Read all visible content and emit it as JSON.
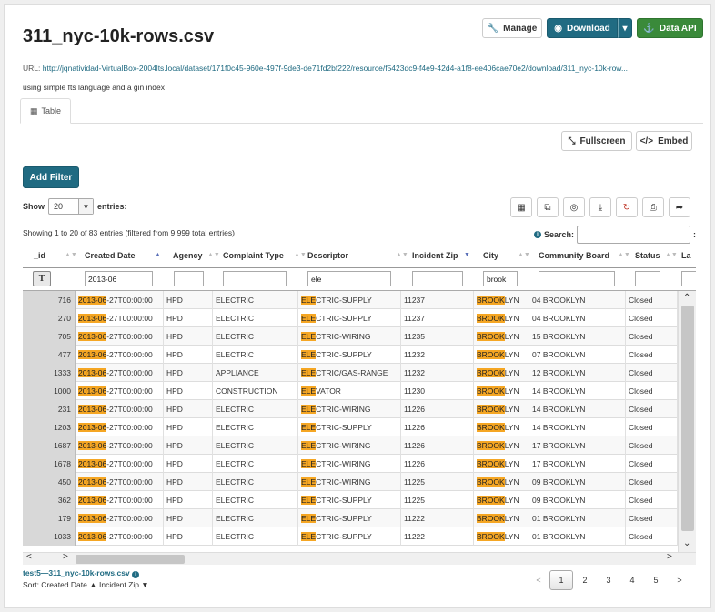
{
  "page": {
    "title": "311_nyc-10k-rows.csv"
  },
  "actions": {
    "manage": "Manage",
    "download": "Download",
    "data_api": "Data API"
  },
  "url": {
    "label": "URL:",
    "href": "http://jqnatividad-VirtualBox-2004lts.local/dataset/171f0c45-960e-497f-9de3-de71fd2bf222/resource/f5423dc9-f4e9-42d4-a1f8-ee406cae70e2/download/311_nyc-10k-row..."
  },
  "description": "using simple fts language and a gin index",
  "tabs": [
    {
      "label": "Table"
    }
  ],
  "view_buttons": {
    "fullscreen": "Fullscreen",
    "embed": "Embed"
  },
  "add_filter": "Add Filter",
  "length": {
    "show": "Show",
    "value": "20",
    "entries": "entries:"
  },
  "info": "Showing 1 to 20 of 83 entries (filtered from 9,999 total entries)",
  "search": {
    "label": "Search:",
    "value": "",
    "trailing": ":"
  },
  "columns": [
    "_id",
    "Created Date",
    "Agency",
    "Complaint Type",
    "Descriptor",
    "Incident Zip",
    "City",
    "Community Board",
    "Status",
    "La"
  ],
  "filters": {
    "created_date": "2013-06",
    "agency": "",
    "complaint_type": "",
    "descriptor": "ele",
    "incident_zip": "",
    "city": "brook",
    "community_board": "",
    "status": "",
    "la": ""
  },
  "highlight": {
    "date": "2013-06",
    "descriptor": "ELE",
    "city": "BROOK"
  },
  "rows": [
    {
      "id": "716",
      "date_rest": "-27T00:00:00",
      "agency": "HPD",
      "type": "ELECTRIC",
      "desc_rest": "CTRIC-SUPPLY",
      "zip": "11237",
      "city_rest": "LYN",
      "board": "04 BROOKLYN",
      "status": "Closed"
    },
    {
      "id": "270",
      "date_rest": "-27T00:00:00",
      "agency": "HPD",
      "type": "ELECTRIC",
      "desc_rest": "CTRIC-SUPPLY",
      "zip": "11237",
      "city_rest": "LYN",
      "board": "04 BROOKLYN",
      "status": "Closed"
    },
    {
      "id": "705",
      "date_rest": "-27T00:00:00",
      "agency": "HPD",
      "type": "ELECTRIC",
      "desc_rest": "CTRIC-WIRING",
      "zip": "11235",
      "city_rest": "LYN",
      "board": "15 BROOKLYN",
      "status": "Closed"
    },
    {
      "id": "477",
      "date_rest": "-27T00:00:00",
      "agency": "HPD",
      "type": "ELECTRIC",
      "desc_rest": "CTRIC-SUPPLY",
      "zip": "11232",
      "city_rest": "LYN",
      "board": "07 BROOKLYN",
      "status": "Closed"
    },
    {
      "id": "1333",
      "date_rest": "-27T00:00:00",
      "agency": "HPD",
      "type": "APPLIANCE",
      "desc_rest": "CTRIC/GAS-RANGE",
      "zip": "11232",
      "city_rest": "LYN",
      "board": "12 BROOKLYN",
      "status": "Closed"
    },
    {
      "id": "1000",
      "date_rest": "-27T00:00:00",
      "agency": "HPD",
      "type": "CONSTRUCTION",
      "desc_rest": "VATOR",
      "zip": "11230",
      "city_rest": "LYN",
      "board": "14 BROOKLYN",
      "status": "Closed"
    },
    {
      "id": "231",
      "date_rest": "-27T00:00:00",
      "agency": "HPD",
      "type": "ELECTRIC",
      "desc_rest": "CTRIC-WIRING",
      "zip": "11226",
      "city_rest": "LYN",
      "board": "14 BROOKLYN",
      "status": "Closed"
    },
    {
      "id": "1203",
      "date_rest": "-27T00:00:00",
      "agency": "HPD",
      "type": "ELECTRIC",
      "desc_rest": "CTRIC-SUPPLY",
      "zip": "11226",
      "city_rest": "LYN",
      "board": "14 BROOKLYN",
      "status": "Closed"
    },
    {
      "id": "1687",
      "date_rest": "-27T00:00:00",
      "agency": "HPD",
      "type": "ELECTRIC",
      "desc_rest": "CTRIC-WIRING",
      "zip": "11226",
      "city_rest": "LYN",
      "board": "17 BROOKLYN",
      "status": "Closed"
    },
    {
      "id": "1678",
      "date_rest": "-27T00:00:00",
      "agency": "HPD",
      "type": "ELECTRIC",
      "desc_rest": "CTRIC-WIRING",
      "zip": "11226",
      "city_rest": "LYN",
      "board": "17 BROOKLYN",
      "status": "Closed"
    },
    {
      "id": "450",
      "date_rest": "-27T00:00:00",
      "agency": "HPD",
      "type": "ELECTRIC",
      "desc_rest": "CTRIC-WIRING",
      "zip": "11225",
      "city_rest": "LYN",
      "board": "09 BROOKLYN",
      "status": "Closed"
    },
    {
      "id": "362",
      "date_rest": "-27T00:00:00",
      "agency": "HPD",
      "type": "ELECTRIC",
      "desc_rest": "CTRIC-SUPPLY",
      "zip": "11225",
      "city_rest": "LYN",
      "board": "09 BROOKLYN",
      "status": "Closed"
    },
    {
      "id": "179",
      "date_rest": "-27T00:00:00",
      "agency": "HPD",
      "type": "ELECTRIC",
      "desc_rest": "CTRIC-SUPPLY",
      "zip": "11222",
      "city_rest": "LYN",
      "board": "01 BROOKLYN",
      "status": "Closed"
    },
    {
      "id": "1033",
      "date_rest": "-27T00:00:00",
      "agency": "HPD",
      "type": "ELECTRIC",
      "desc_rest": "CTRIC-SUPPLY",
      "zip": "11222",
      "city_rest": "LYN",
      "board": "01 BROOKLYN",
      "status": "Closed"
    }
  ],
  "footer": {
    "resource_name": "test5—311_nyc-10k-rows.csv",
    "sort": "Sort: Created Date ▲ Incident Zip ▼"
  },
  "pagination": {
    "prev": "<",
    "pages": [
      "1",
      "2",
      "3",
      "4",
      "5"
    ],
    "next": ">"
  },
  "icons": {
    "manage": "wrench-icon",
    "download": "download-circle-icon",
    "api": "flask-icon",
    "table": "table-icon",
    "fullscreen": "expand-icon",
    "embed": "code-icon"
  },
  "colors": {
    "primary": "#206b82",
    "success": "#3a8a3a",
    "highlight": "#f5a623"
  }
}
